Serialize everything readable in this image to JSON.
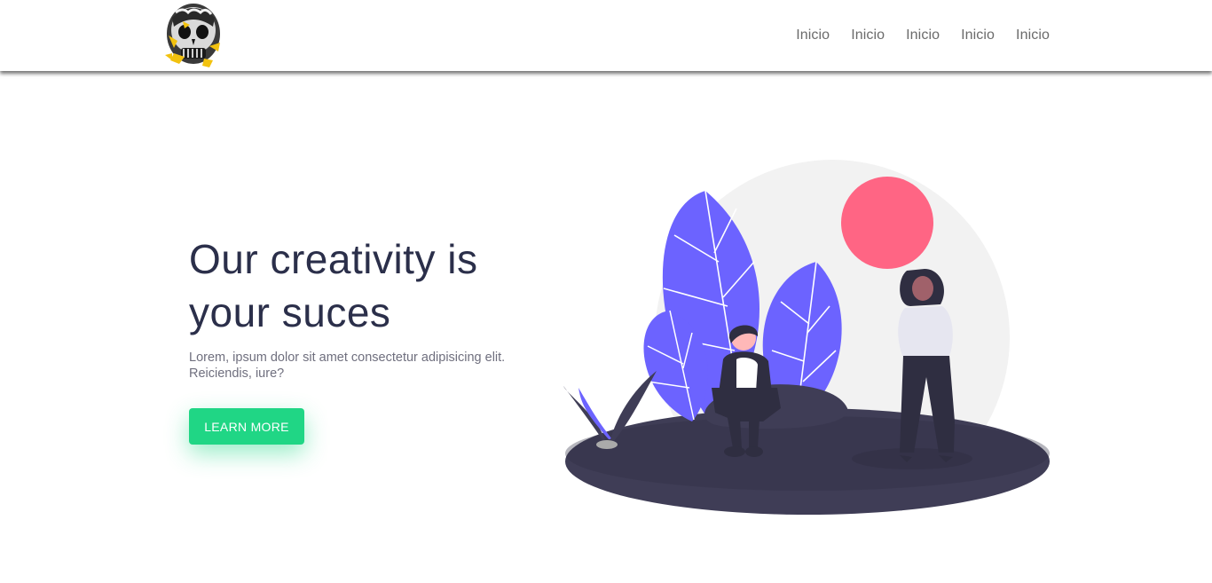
{
  "navbar": {
    "logo_icon": "skull-logo-icon",
    "links": [
      "Inicio",
      "Inicio",
      "Inicio",
      "Inicio",
      "Inicio"
    ]
  },
  "hero": {
    "title_line1": "Our creativity is",
    "title_line2": "your suces",
    "subtitle_line1": "Lorem, ipsum dolor sit amet consectetur adipisicing elit.",
    "subtitle_line2": "Reiciendis, iure?",
    "cta_label": "LEARN MORE"
  },
  "colors": {
    "accent_green": "#20d685",
    "illustration_purple": "#6c63ff",
    "illustration_red": "#ff6584",
    "ground_dark": "#3f3d56",
    "title_text": "#2b2f4a"
  },
  "illustration": {
    "icon": "people-with-plants-illustration"
  }
}
